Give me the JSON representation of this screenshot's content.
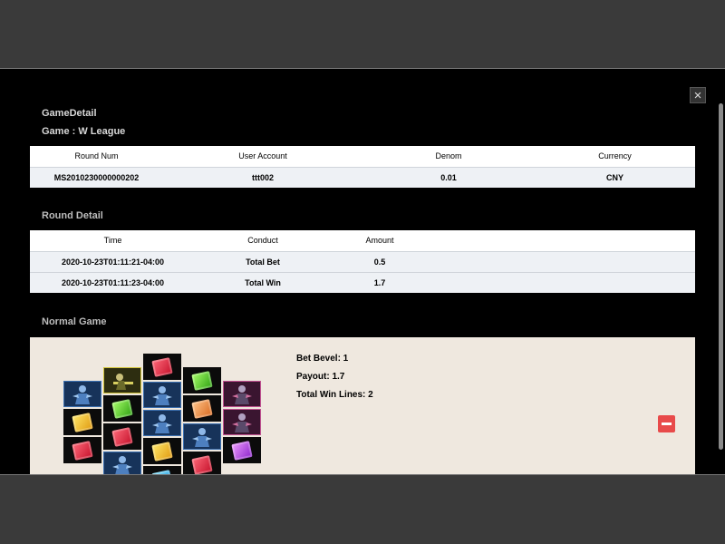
{
  "modal": {
    "close_label": "×",
    "heading": "GameDetail",
    "game_label": "Game : W League"
  },
  "summary_table": {
    "headers": [
      "Round Num",
      "User Account",
      "Denom",
      "Currency"
    ],
    "row": [
      "MS2010230000000202",
      "ttt002",
      "0.01",
      "CNY"
    ]
  },
  "round_detail": {
    "title": "Round Detail",
    "headers": [
      "Time",
      "Conduct",
      "Amount"
    ],
    "rows": [
      [
        "2020-10-23T01:11:21-04:00",
        "Total Bet",
        "0.5"
      ],
      [
        "2020-10-23T01:11:23-04:00",
        "Total Win",
        "1.7"
      ]
    ]
  },
  "normal_game": {
    "title": "Normal Game",
    "bet_level": "Bet Bevel: 1",
    "payout": "Payout: 1.7",
    "total_win_lines": "Total Win Lines: 2",
    "reels": [
      [
        "hero-blue-icon",
        "yellow-gem-icon",
        "red-gem-icon"
      ],
      [
        "sniper-wild-icon",
        "green-gem-icon",
        "red-gem-icon",
        "hero-blue-icon"
      ],
      [
        "red-gem-icon",
        "hero-blue-icon",
        "hero-blue-icon",
        "yellow-gem-icon",
        "cyan-gem-icon"
      ],
      [
        "green-gem-icon",
        "orange-gem-icon",
        "hero-blue-icon",
        "red-gem-icon"
      ],
      [
        "hero-pink-icon",
        "hero-pink-icon",
        "purple-gem-icon"
      ]
    ]
  },
  "colors": {
    "modal_bg": "#000000",
    "panel_bg": "#efe8df",
    "accent_red": "#e84a4a",
    "row_bg": "#eef1f5"
  }
}
